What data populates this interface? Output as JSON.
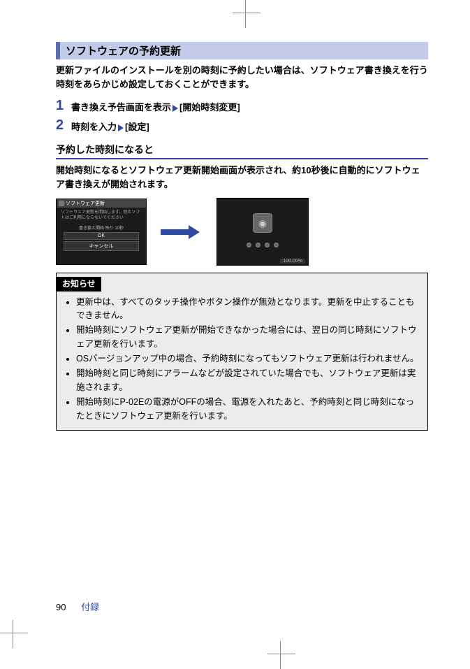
{
  "section_title": "ソフトウェアの予約更新",
  "intro": "更新ファイルのインストールを別の時刻に予約したい場合は、ソフトウェア書き換えを行う時刻をあらかじめ設定しておくことができます。",
  "steps": [
    {
      "num": "1",
      "pre": "書き換え予告画面を表示",
      "bracket": "[開始時刻変更]"
    },
    {
      "num": "2",
      "pre": "時刻を入力",
      "bracket": "[設定]"
    }
  ],
  "sub_header": "予約した時刻になると",
  "sub_body": "開始時刻になるとソフトウェア更新開始画面が表示され、約10秒後に自動的にソフトウェア書き換えが開始されます。",
  "screen1": {
    "topbar": "ソフトウェア更新",
    "msg": "ソフトウェア更新を開始します。他のソフトはご利用にならないでください",
    "time": "書き換え開始 残り 10秒",
    "ok": "OK",
    "cancel": "キャンセル"
  },
  "screen2": {
    "progress": "100.00%"
  },
  "notice": {
    "title": "お知らせ",
    "items": [
      "更新中は、すべてのタッチ操作やボタン操作が無効となります。更新を中止することもできません。",
      "開始時刻にソフトウェア更新が開始できなかった場合には、翌日の同じ時刻にソフトウェア更新を行います。",
      "OSバージョンアップ中の場合、予約時刻になってもソフトウェア更新は行われません。",
      "開始時刻と同じ時刻にアラームなどが設定されていた場合でも、ソフトウェア更新は実施されます。",
      "開始時刻にP-02Eの電源がOFFの場合、電源を入れたあと、予約時刻と同じ時刻になったときにソフトウェア更新を行います。"
    ]
  },
  "footer": {
    "page": "90",
    "section": "付録"
  }
}
